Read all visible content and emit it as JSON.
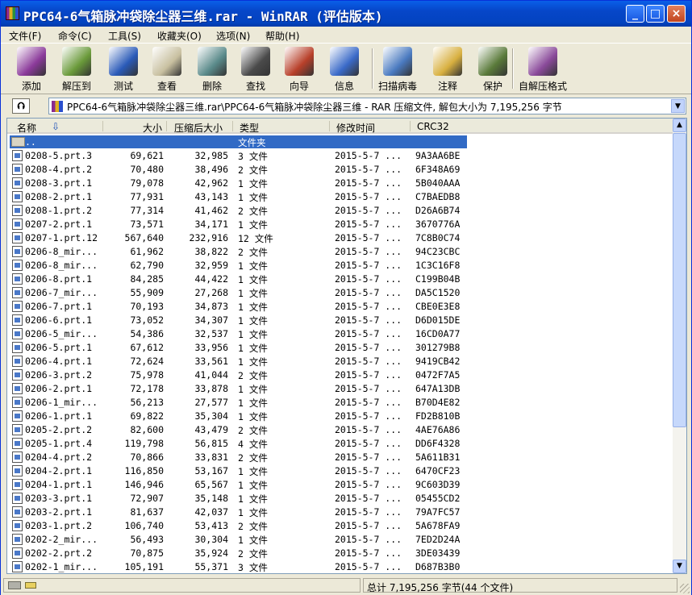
{
  "window": {
    "title": "PPC64-6气箱脉冲袋除尘器三维.rar - WinRAR (评估版本)",
    "min": "_",
    "max": "□",
    "close": "×"
  },
  "menu": [
    "文件(F)",
    "命令(C)",
    "工具(S)",
    "收藏夹(O)",
    "选项(N)",
    "帮助(H)"
  ],
  "toolbar": [
    {
      "label": "添加",
      "icon": "add-icon",
      "color": "#8b3a9a"
    },
    {
      "label": "解压到",
      "icon": "extract-to-icon",
      "color": "#6a9a3a"
    },
    {
      "label": "测试",
      "icon": "test-icon",
      "color": "#2a5ab8"
    },
    {
      "label": "查看",
      "icon": "view-icon",
      "color": "#c8c0a0"
    },
    {
      "label": "删除",
      "icon": "delete-icon",
      "color": "#5a8a8a"
    },
    {
      "label": "查找",
      "icon": "find-icon",
      "color": "#4a4a4a"
    },
    {
      "label": "向导",
      "icon": "wizard-icon",
      "color": "#b8402a"
    },
    {
      "label": "信息",
      "icon": "info-icon",
      "color": "#3a6ac8"
    },
    {
      "label": "扫描病毒",
      "icon": "scan-virus-icon",
      "color": "#4a7ac0"
    },
    {
      "label": "注释",
      "icon": "comment-icon",
      "color": "#d8b040"
    },
    {
      "label": "保护",
      "icon": "protect-icon",
      "color": "#5a7a3a"
    },
    {
      "label": "自解压格式",
      "icon": "sfx-icon",
      "color": "#8a4a9a"
    }
  ],
  "address": {
    "up": "⮉",
    "path": "PPC64-6气箱脉冲袋除尘器三维.rar\\PPC64-6气箱脉冲袋除尘器三维 - RAR 压缩文件, 解包大小为 7,195,256 字节",
    "dropdown": "▼"
  },
  "columns": {
    "name": "名称",
    "size": "大小",
    "packed": "压缩后大小",
    "type": "类型",
    "modified": "修改时间",
    "crc": "CRC32",
    "sort": "⇩"
  },
  "parent_row": {
    "name": "..",
    "type": "文件夹"
  },
  "files": [
    [
      "0208-5.prt.3",
      "69,621",
      "32,985",
      "3 文件",
      "2015-5-7 ...",
      "9A3AA6BE"
    ],
    [
      "0208-4.prt.2",
      "70,480",
      "38,496",
      "2 文件",
      "2015-5-7 ...",
      "6F348A69"
    ],
    [
      "0208-3.prt.1",
      "79,078",
      "42,962",
      "1 文件",
      "2015-5-7 ...",
      "5B040AAA"
    ],
    [
      "0208-2.prt.1",
      "77,931",
      "43,143",
      "1 文件",
      "2015-5-7 ...",
      "C7BAEDB8"
    ],
    [
      "0208-1.prt.2",
      "77,314",
      "41,462",
      "2 文件",
      "2015-5-7 ...",
      "D26A6B74"
    ],
    [
      "0207-2.prt.1",
      "73,571",
      "34,171",
      "1 文件",
      "2015-5-7 ...",
      "3670776A"
    ],
    [
      "0207-1.prt.12",
      "567,640",
      "232,916",
      "12 文件",
      "2015-5-7 ...",
      "7C8B0C74"
    ],
    [
      "0206-8_mir...",
      "61,962",
      "38,822",
      "2 文件",
      "2015-5-7 ...",
      "94C23CBC"
    ],
    [
      "0206-8_mir...",
      "62,790",
      "32,959",
      "1 文件",
      "2015-5-7 ...",
      "1C3C16F8"
    ],
    [
      "0206-8.prt.1",
      "84,285",
      "44,422",
      "1 文件",
      "2015-5-7 ...",
      "C199B04B"
    ],
    [
      "0206-7_mir...",
      "55,909",
      "27,268",
      "1 文件",
      "2015-5-7 ...",
      "DA5C1520"
    ],
    [
      "0206-7.prt.1",
      "70,193",
      "34,873",
      "1 文件",
      "2015-5-7 ...",
      "CBE0E3E8"
    ],
    [
      "0206-6.prt.1",
      "73,052",
      "34,307",
      "1 文件",
      "2015-5-7 ...",
      "D6D015DE"
    ],
    [
      "0206-5_mir...",
      "54,386",
      "32,537",
      "1 文件",
      "2015-5-7 ...",
      "16CD0A77"
    ],
    [
      "0206-5.prt.1",
      "67,612",
      "33,956",
      "1 文件",
      "2015-5-7 ...",
      "301279B8"
    ],
    [
      "0206-4.prt.1",
      "72,624",
      "33,561",
      "1 文件",
      "2015-5-7 ...",
      "9419CB42"
    ],
    [
      "0206-3.prt.2",
      "75,978",
      "41,044",
      "2 文件",
      "2015-5-7 ...",
      "0472F7A5"
    ],
    [
      "0206-2.prt.1",
      "72,178",
      "33,878",
      "1 文件",
      "2015-5-7 ...",
      "647A13DB"
    ],
    [
      "0206-1_mir...",
      "56,213",
      "27,577",
      "1 文件",
      "2015-5-7 ...",
      "B70D4E82"
    ],
    [
      "0206-1.prt.1",
      "69,822",
      "35,304",
      "1 文件",
      "2015-5-7 ...",
      "FD2B810B"
    ],
    [
      "0205-2.prt.2",
      "82,600",
      "43,479",
      "2 文件",
      "2015-5-7 ...",
      "4AE76A86"
    ],
    [
      "0205-1.prt.4",
      "119,798",
      "56,815",
      "4 文件",
      "2015-5-7 ...",
      "DD6F4328"
    ],
    [
      "0204-4.prt.2",
      "70,866",
      "33,831",
      "2 文件",
      "2015-5-7 ...",
      "5A611B31"
    ],
    [
      "0204-2.prt.1",
      "116,850",
      "53,167",
      "1 文件",
      "2015-5-7 ...",
      "6470CF23"
    ],
    [
      "0204-1.prt.1",
      "146,946",
      "65,567",
      "1 文件",
      "2015-5-7 ...",
      "9C603D39"
    ],
    [
      "0203-3.prt.1",
      "72,907",
      "35,148",
      "1 文件",
      "2015-5-7 ...",
      "05455CD2"
    ],
    [
      "0203-2.prt.1",
      "81,637",
      "42,037",
      "1 文件",
      "2015-5-7 ...",
      "79A7FC57"
    ],
    [
      "0203-1.prt.2",
      "106,740",
      "53,413",
      "2 文件",
      "2015-5-7 ...",
      "5A678FA9"
    ],
    [
      "0202-2_mir...",
      "56,493",
      "30,304",
      "1 文件",
      "2015-5-7 ...",
      "7ED2D24A"
    ],
    [
      "0202-2.prt.2",
      "70,875",
      "35,924",
      "2 文件",
      "2015-5-7 ...",
      "3DE03439"
    ],
    [
      "0202-1_mir...",
      "105,191",
      "55,371",
      "3 文件",
      "2015-5-7 ...",
      "D687B3B0"
    ]
  ],
  "status": {
    "total": "总计 7,195,256 字节(44 个文件)"
  },
  "scroll": {
    "up": "▲",
    "down": "▼"
  }
}
